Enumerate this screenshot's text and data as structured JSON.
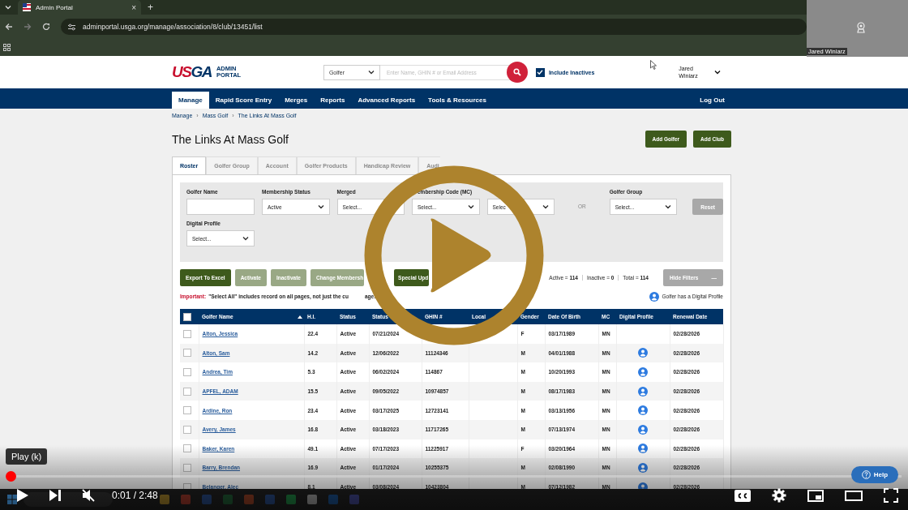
{
  "browser": {
    "tab_title": "Admin Portal",
    "close": "×",
    "new_tab": "+",
    "url": "adminportal.usga.org/manage/association/8/club/13451/list"
  },
  "webcam": {
    "name": "Jared Winiarz"
  },
  "header": {
    "logo": [
      {
        "text": "US",
        "color": "#c8102e"
      },
      {
        "text": "GA",
        "color": "#003366"
      }
    ],
    "logo_sub": "ADMIN PORTAL",
    "search_type": "Golfer",
    "search_placeholder": "Enter Name, GHIN # or Email Address",
    "include_inactives": {
      "label": "Include Inactives",
      "checked": true
    },
    "user": "Jared Winiarz"
  },
  "nav": [
    {
      "label": "Manage",
      "selected": true
    },
    {
      "label": "Rapid Score Entry",
      "selected": false
    },
    {
      "label": "Merges",
      "selected": false
    },
    {
      "label": "Reports",
      "selected": false
    },
    {
      "label": "Advanced Reports",
      "selected": false
    },
    {
      "label": "Tools & Resources",
      "selected": false
    }
  ],
  "logout": "Log Out",
  "breadcrumb": {
    "items": [
      "Manage",
      "Mass Golf",
      "The Links At Mass Golf"
    ],
    "separator": "›"
  },
  "title": "The Links At Mass Golf",
  "header_buttons": [
    "Add Golfer",
    "Add Club"
  ],
  "tabs": [
    {
      "label": "Roster",
      "selected": true
    },
    {
      "label": "Golfer Group",
      "selected": false
    },
    {
      "label": "Account",
      "selected": false
    },
    {
      "label": "Golfer Products",
      "selected": false
    },
    {
      "label": "Handicap Review",
      "selected": false
    },
    {
      "label": "Audi",
      "selected": false
    }
  ],
  "filter_rows": [
    [
      {
        "kind": "text",
        "label": "Golfer Name"
      },
      {
        "kind": "select",
        "label": "Membership Status",
        "value": "Active",
        "caret": true
      },
      {
        "kind": "select",
        "label": "Merged",
        "value": "Select...",
        "caret": false
      },
      {
        "kind": "select",
        "label": "embership Code (MC)",
        "value": "Select...",
        "caret": true
      },
      {
        "kind": "select",
        "value": "Selec",
        "caret": true
      },
      {
        "kind": "or",
        "value": "OR"
      },
      {
        "kind": "select",
        "label": "Golfer Group",
        "value": "Select...",
        "caret": true
      },
      {
        "kind": "button",
        "value": "Reset"
      }
    ],
    [
      {
        "kind": "select",
        "label": "Digital Profile",
        "value": "Select...",
        "caret": true
      }
    ]
  ],
  "actions": [
    {
      "label": "Export To Excel",
      "disabled": false
    },
    {
      "label": "Activate",
      "disabled": true
    },
    {
      "label": "Inactivate",
      "disabled": true
    },
    {
      "label": "Change Membersh",
      "disabled": true
    },
    {
      "label": "Special Upd",
      "disabled": false
    }
  ],
  "counts": [
    "Active = **114**",
    "Inactive = **0**",
    "Total = **114**"
  ],
  "hide_filters": {
    "label": "Hide Filters",
    "icon": "—"
  },
  "notice": {
    "label": "Important:",
    "text": "\"Select All\" includes record on all pages, not just the cu",
    "tail": "age."
  },
  "legend": "Golfer has a Digital Profile",
  "table": {
    "select_all_checked": false,
    "columns": [
      {
        "label": "Golfer Name",
        "sorted": true
      },
      {
        "label": "H.I.",
        "sorted": false
      },
      {
        "label": "Status",
        "sorted": false
      },
      {
        "label": "Status",
        "sorted": false
      },
      {
        "label": "GHIN #",
        "sorted": false
      },
      {
        "label": "Local",
        "sorted": false
      },
      {
        "label": "Gender",
        "sorted": false
      },
      {
        "label": "Date Of Birth",
        "sorted": false
      },
      {
        "label": "MC",
        "sorted": false
      },
      {
        "label": "Digital Profile",
        "sorted": false
      },
      {
        "label": "Renewal Date",
        "sorted": false
      }
    ],
    "rows": [
      {
        "checked": false,
        "name": "Alton, Jessica",
        "hi": "22.4",
        "status": "Active",
        "status_date": "07/21/2024",
        "gender": "F",
        "dob": "03/17/1989",
        "mc": "MN",
        "digital_profile": false,
        "renewal": "02/28/2026"
      },
      {
        "checked": false,
        "name": "Alton, Sam",
        "hi": "14.2",
        "status": "Active",
        "status_date": "12/06/2022",
        "ghin": "11124346",
        "gender": "M",
        "dob": "04/01/1988",
        "mc": "MN",
        "digital_profile": true,
        "renewal": "02/28/2026"
      },
      {
        "checked": false,
        "name": "Andrea, Tim",
        "hi": "5.3",
        "status": "Active",
        "status_date": "06/02/2024",
        "ghin": "114867",
        "gender": "M",
        "dob": "10/20/1993",
        "mc": "MN",
        "digital_profile": true,
        "renewal": "02/28/2026"
      },
      {
        "checked": false,
        "name": "APFEL, ADAM",
        "hi": "15.5",
        "status": "Active",
        "status_date": "09/05/2022",
        "ghin": "10974857",
        "gender": "M",
        "dob": "08/17/1983",
        "mc": "MN",
        "digital_profile": true,
        "renewal": "02/28/2026"
      },
      {
        "checked": false,
        "name": "Ardine, Ron",
        "hi": "23.4",
        "status": "Active",
        "status_date": "03/17/2025",
        "ghin": "12723141",
        "gender": "M",
        "dob": "03/13/1956",
        "mc": "MN",
        "digital_profile": true,
        "renewal": "02/28/2026"
      },
      {
        "checked": false,
        "name": "Avery, James",
        "hi": "16.8",
        "status": "Active",
        "status_date": "03/18/2023",
        "ghin": "11717265",
        "gender": "M",
        "dob": "07/13/1974",
        "mc": "MN",
        "digital_profile": true,
        "renewal": "02/28/2026"
      },
      {
        "checked": false,
        "name": "Baker, Karen",
        "hi": "49.1",
        "status": "Active",
        "status_date": "07/17/2023",
        "ghin": "11225917",
        "gender": "F",
        "dob": "03/20/1964",
        "mc": "MN",
        "digital_profile": true,
        "renewal": "02/28/2026"
      },
      {
        "checked": false,
        "name": "Barry, Brendan",
        "hi": "16.9",
        "status": "Active",
        "status_date": "01/17/2024",
        "ghin": "10255375",
        "gender": "M",
        "dob": "02/08/1990",
        "mc": "MN",
        "digital_profile": true,
        "renewal": "02/28/2026"
      },
      {
        "checked": false,
        "name": "Belanger, Alec",
        "hi": "8.1",
        "status": "Active",
        "status_date": "03/08/2024",
        "ghin": "10423804",
        "gender": "M",
        "dob": "07/12/1982",
        "mc": "MN",
        "digital_profile": true,
        "renewal": "02/28/2026"
      }
    ]
  },
  "help": "Help",
  "player": {
    "tooltip": "Play (k)",
    "time": "0:01 / 2:48",
    "level": 0.01
  }
}
